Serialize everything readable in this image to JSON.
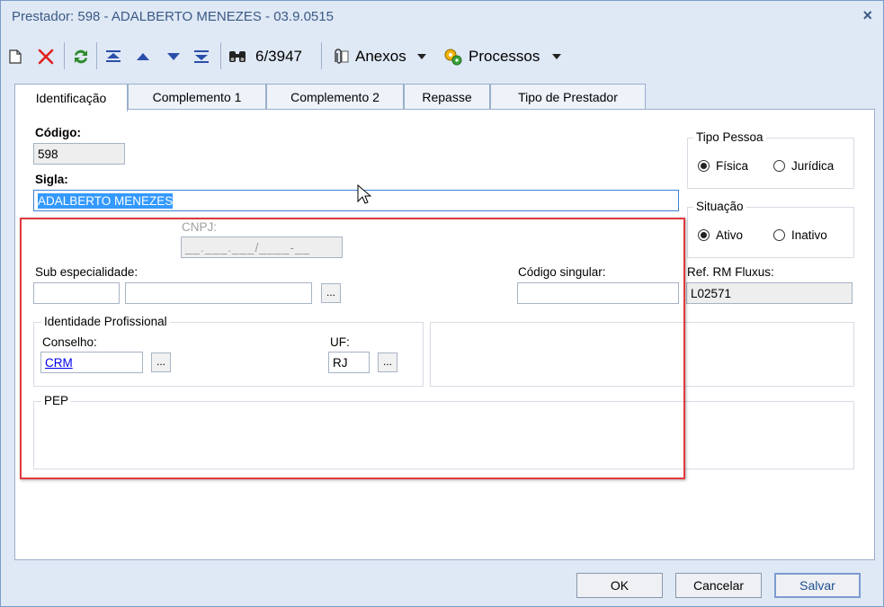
{
  "window": {
    "title": "Prestador: 598 - ADALBERTO MENEZES - 03.9.0515",
    "close": "×"
  },
  "toolbar": {
    "record_counter": "6/3947",
    "anexos_label": "Anexos",
    "processos_label": "Processos",
    "icons": [
      "new-icon",
      "delete-icon",
      "refresh-icon",
      "first-record-icon",
      "previous-record-icon",
      "next-record-icon",
      "last-record-icon",
      "binoculars-icon",
      "paperclip-icon",
      "processos-icon"
    ]
  },
  "tabs": [
    "Identificação",
    "Complemento 1",
    "Complemento 2",
    "Repasse",
    "Tipo de Prestador"
  ],
  "form": {
    "codigo_label": "Código:",
    "codigo_value": "598",
    "sigla_label": "Sigla:",
    "sigla_value": "ADALBERTO MENEZES",
    "cnpj_label": "CNPJ:",
    "cnpj_mask": "__.___.___/____-__",
    "sub_especialidade_label": "Sub especialidade:",
    "sub_code_value": "",
    "sub_desc_value": "",
    "codigo_singular_label": "Código singular:",
    "codigo_singular_value": "",
    "identidade_title": "Identidade Profissional",
    "conselho_label": "Conselho:",
    "conselho_value": "CRM",
    "uf_label": "UF:",
    "uf_value": "RJ",
    "pep_title": "PEP",
    "dots": "..."
  },
  "tipo_pessoa": {
    "title": "Tipo Pessoa",
    "options": [
      "Física",
      "Jurídica"
    ],
    "selected": "Física"
  },
  "situacao": {
    "title": "Situação",
    "options": [
      "Ativo",
      "Inativo"
    ],
    "selected": "Ativo"
  },
  "ref_rm": {
    "label": "Ref. RM Fluxus:",
    "value": "L02571"
  },
  "buttons": {
    "ok": "OK",
    "cancelar": "Cancelar",
    "salvar": "Salvar"
  },
  "colors": {
    "highlight_box": "#e0393e",
    "selection": "#3399ff",
    "link": "#0000ee",
    "title_text": "#3b5a86"
  }
}
